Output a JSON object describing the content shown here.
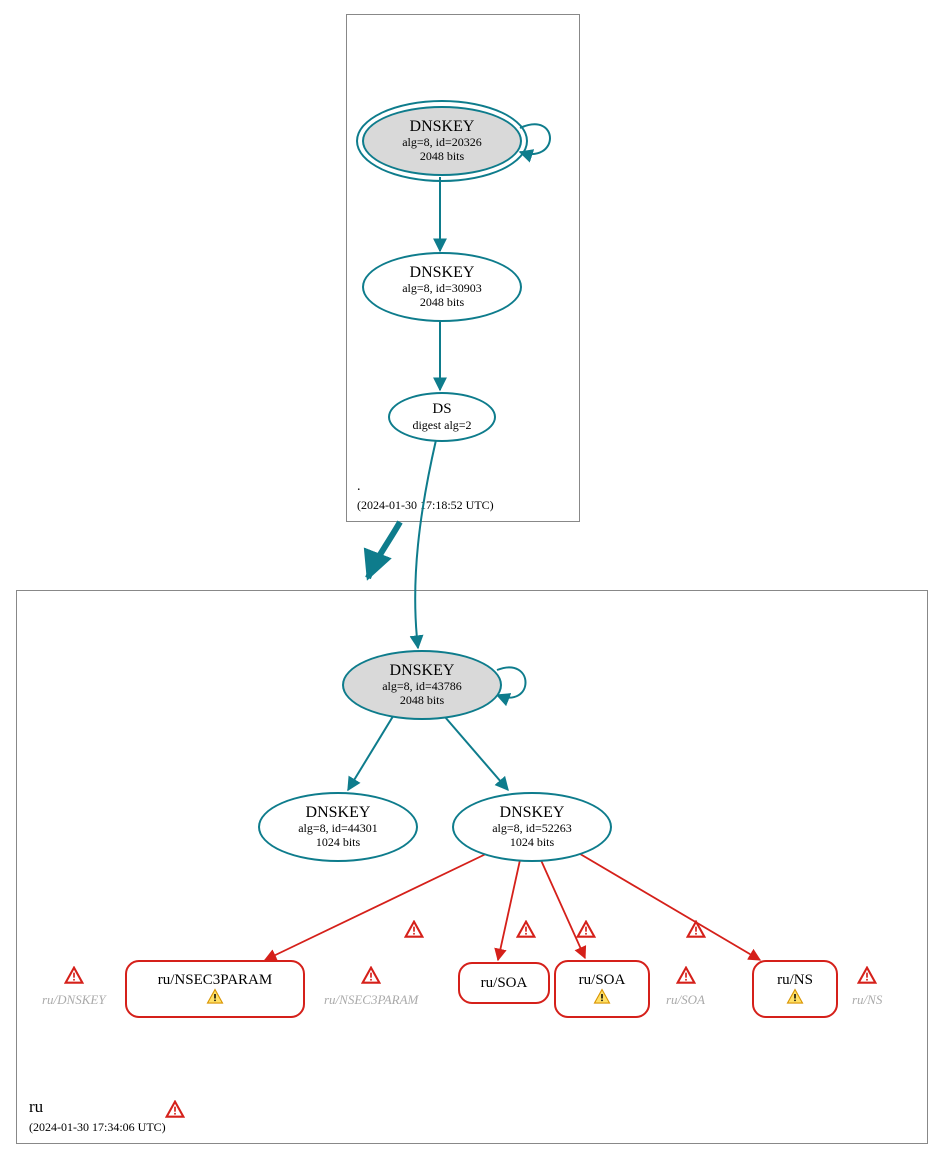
{
  "zone_root": {
    "name": ".",
    "timestamp": "(2024-01-30 17:18:52 UTC)"
  },
  "zone_ru": {
    "name": "ru",
    "timestamp": "(2024-01-30 17:34:06 UTC)"
  },
  "nodes": {
    "root_ksk": {
      "title": "DNSKEY",
      "line2": "alg=8, id=20326",
      "line3": "2048 bits"
    },
    "root_zsk": {
      "title": "DNSKEY",
      "line2": "alg=8, id=30903",
      "line3": "2048 bits"
    },
    "root_ds": {
      "title": "DS",
      "line2": "digest alg=2"
    },
    "ru_ksk": {
      "title": "DNSKEY",
      "line2": "alg=8, id=43786",
      "line3": "2048 bits"
    },
    "ru_zsk1": {
      "title": "DNSKEY",
      "line2": "alg=8, id=44301",
      "line3": "1024 bits"
    },
    "ru_zsk2": {
      "title": "DNSKEY",
      "line2": "alg=8, id=52263",
      "line3": "1024 bits"
    }
  },
  "rr": {
    "nsec3param": "ru/NSEC3PARAM",
    "soa1": "ru/SOA",
    "soa2": "ru/SOA",
    "ns": "ru/NS"
  },
  "ghosts": {
    "dnskey": "ru/DNSKEY",
    "nsec3param": "ru/NSEC3PARAM",
    "soa": "ru/SOA",
    "ns": "ru/NS"
  }
}
